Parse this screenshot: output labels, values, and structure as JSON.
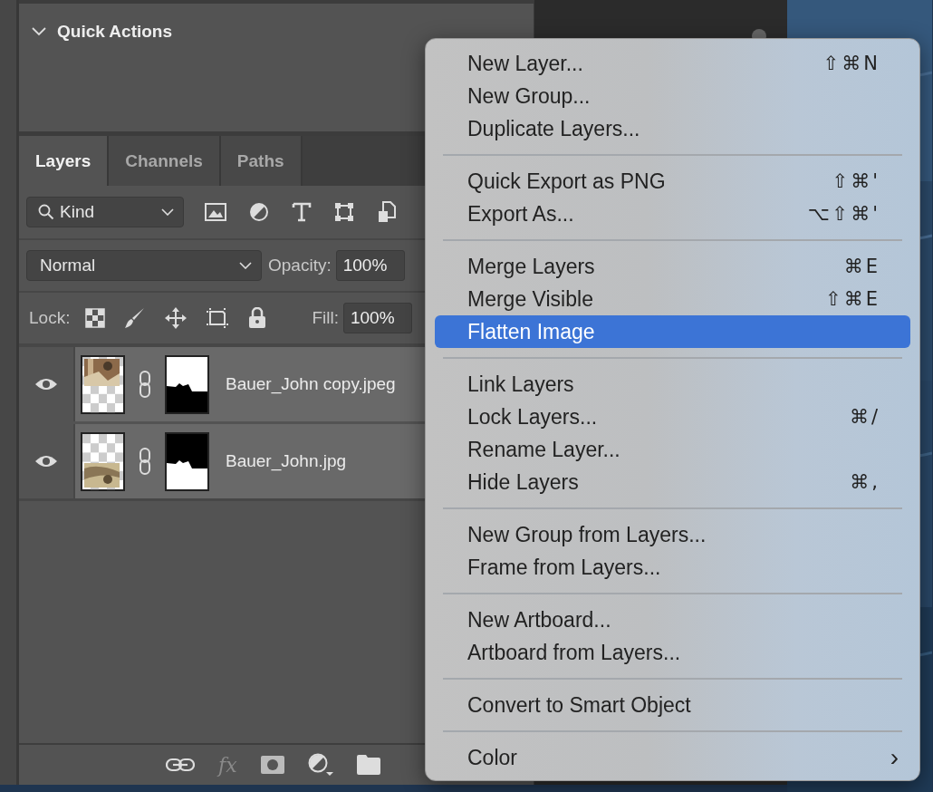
{
  "quick_actions": {
    "title": "Quick Actions",
    "expanded": true
  },
  "tabs": [
    {
      "label": "Layers",
      "selected": true
    },
    {
      "label": "Channels",
      "selected": false
    },
    {
      "label": "Paths",
      "selected": false
    }
  ],
  "filter": {
    "value": "Kind"
  },
  "blend": {
    "mode": "Normal",
    "opacity_label": "Opacity:",
    "opacity": "100%"
  },
  "lock": {
    "label": "Lock:",
    "fill_label": "Fill:",
    "fill": "100%"
  },
  "layers": [
    {
      "name": "Bauer_John copy.jpeg",
      "visible": true,
      "photo_on_top": true
    },
    {
      "name": "Bauer_John.jpg",
      "visible": true,
      "photo_on_top": false
    }
  ],
  "bottom_toolbar": {
    "fx_label": "fx"
  },
  "menu": {
    "groups": [
      [
        {
          "label": "New Layer...",
          "shortcut": "⇧⌘N",
          "selected": false
        },
        {
          "label": "New Group...",
          "selected": false
        },
        {
          "label": "Duplicate Layers...",
          "selected": false
        }
      ],
      [
        {
          "label": "Quick Export as PNG",
          "shortcut": "⇧⌘'",
          "selected": false
        },
        {
          "label": "Export As...",
          "shortcut": "⌥⇧⌘'",
          "selected": false
        }
      ],
      [
        {
          "label": "Merge Layers",
          "shortcut": "⌘E",
          "selected": false
        },
        {
          "label": "Merge Visible",
          "shortcut": "⇧⌘E",
          "selected": false
        },
        {
          "label": "Flatten Image",
          "selected": true
        }
      ],
      [
        {
          "label": "Link Layers",
          "selected": false
        },
        {
          "label": "Lock Layers...",
          "shortcut": "⌘/",
          "selected": false
        },
        {
          "label": "Rename Layer...",
          "selected": false
        },
        {
          "label": "Hide Layers",
          "shortcut": "⌘,",
          "selected": false
        }
      ],
      [
        {
          "label": "New Group from Layers...",
          "selected": false
        },
        {
          "label": "Frame from Layers...",
          "selected": false
        }
      ],
      [
        {
          "label": "New Artboard...",
          "selected": false
        },
        {
          "label": "Artboard from Layers...",
          "selected": false
        }
      ],
      [
        {
          "label": "Convert to Smart Object",
          "selected": false
        }
      ],
      [
        {
          "label": "Color",
          "submenu_arrow": "›",
          "selected": false
        }
      ]
    ]
  }
}
